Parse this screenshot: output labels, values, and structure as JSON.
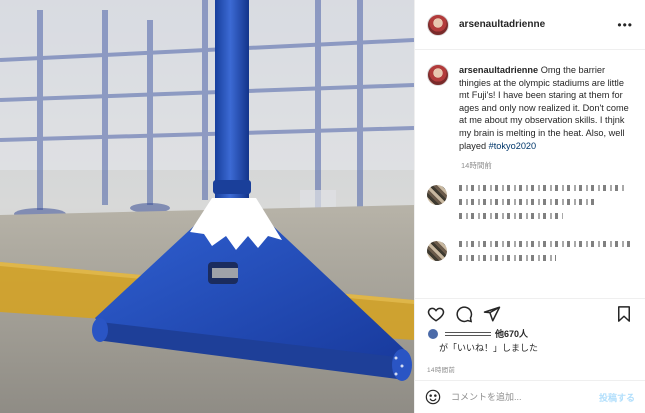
{
  "post": {
    "username": "arsenaultadrienne",
    "caption": {
      "username": "arsenaultadrienne",
      "text": "Omg the barrier thingies at the olympic stadiums are little mt Fuji's! I have been staring at them for ages and only now realized it. Don't come at me about my observation skills. I thjnk my brain is melting in the heat. Also, well played ",
      "hashtag": "#tokyo2020"
    },
    "caption_time": "14時間前",
    "likes": {
      "count_text": "他670人",
      "suffix": "が「いいね！」しました"
    },
    "post_time": "14時間前",
    "comment_placeholder": "コメントを追加...",
    "post_button": "投稿する",
    "icons": {
      "more": "more-icon",
      "like": "heart-icon",
      "comment": "comment-icon",
      "share": "share-icon",
      "save": "bookmark-icon",
      "emoji": "emoji-icon"
    }
  }
}
